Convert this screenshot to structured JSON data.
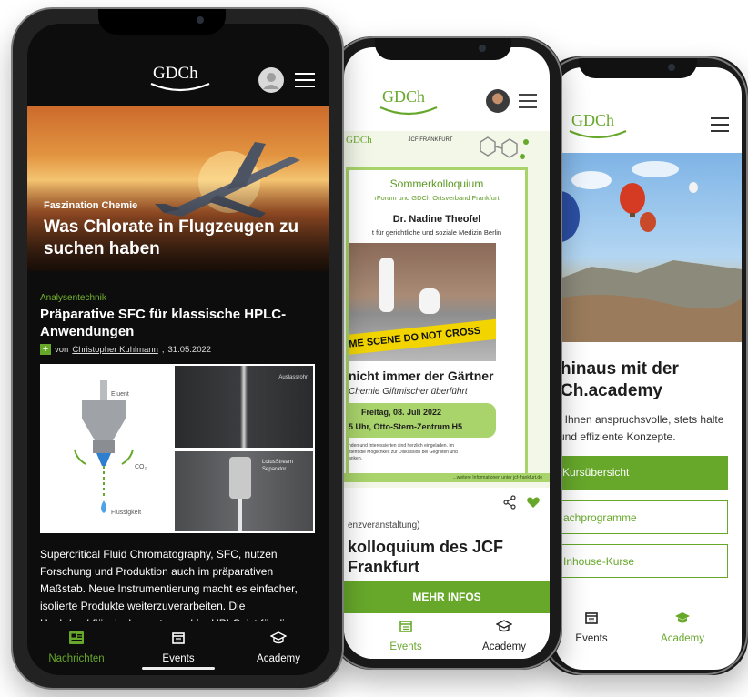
{
  "brand": {
    "logo_text": "GDCh",
    "accent": "#67a82b"
  },
  "phone_front": {
    "hero": {
      "kicker": "Faszination Chemie",
      "title": "Was Chlorate in Flugzeugen zu suchen haben"
    },
    "article": {
      "category": "Analysentechnik",
      "title": "Präparative SFC für klassische HPLC-Anwendungen",
      "byline_prefix": "von",
      "author": "Christopher Kuhlmann",
      "date": "31.05.2022",
      "figure_labels": {
        "eluent": "Eluent",
        "co2": "CO₂",
        "liquid": "Flüssigkeit",
        "outlet": "Auslassrohr",
        "separator_1": "LotusStream",
        "separator_2": "Separator"
      },
      "body": "Supercritical Fluid Chromatography, SFC, nutzen Forschung und Produktion auch im präparativen Maßstab. Neue Instrumentierung macht es einfacher, isolierte Produkte weiterzuverarbeiten. Die Hochdruckflüssigchromatographie, HPLC, ist für die"
    },
    "nav": [
      {
        "label": "Nachrichten",
        "icon": "newspaper-icon",
        "active": true
      },
      {
        "label": "Events",
        "icon": "calendar-icon",
        "active": false
      },
      {
        "label": "Academy",
        "icon": "graduation-cap-icon",
        "active": false
      }
    ]
  },
  "phone_middle": {
    "poster": {
      "header_left": "GDCh",
      "header_mid": "JCF FRANKFURT",
      "event_name": "Sommerkolloquium",
      "organizers": "rForum und GDCh Ortsverband Frankfurt",
      "speaker": "Dr. Nadine Theofel",
      "affiliation": "t für gerichtliche und soziale Medizin Berlin",
      "tape_text": "ME SCENE DO NOT CROSS",
      "headline": "nicht immer der Gärtner",
      "subheadline": "Chemie Giftmischer überführt",
      "date_line": "Freitag, 08. Juli 2022",
      "place_line": "5 Uhr, Otto-Stern-Zentrum H5",
      "small_text_1": "nden und Interessierten sind herzlich eingeladen. Im",
      "small_text_2": "steht die Möglichkeit zur Diskussion bei Gegrillten und",
      "small_text_3": "anken.",
      "footer_text": "...weitere Informationen unter jcf-frankfurt.de"
    },
    "subtitle": "enzveranstaltung)",
    "title": "kolloquium des JCF Frankfurt",
    "button": "MEHR INFOS",
    "nav": [
      {
        "label": "Events",
        "icon": "calendar-icon",
        "active": true
      },
      {
        "label": "Academy",
        "icon": "graduation-cap-icon",
        "active": false
      }
    ]
  },
  "phone_back": {
    "title": "hinaus mit der Ch.academy",
    "text": "t Ihnen anspruchsvolle, stets halte und effiziente Konzepte.",
    "buttons": [
      "Kursübersicht",
      "achprogramme",
      "Inhouse-Kurse"
    ],
    "nav": [
      {
        "label": "Events",
        "icon": "calendar-icon",
        "active": false
      },
      {
        "label": "Academy",
        "icon": "graduation-cap-icon",
        "active": true
      }
    ]
  }
}
